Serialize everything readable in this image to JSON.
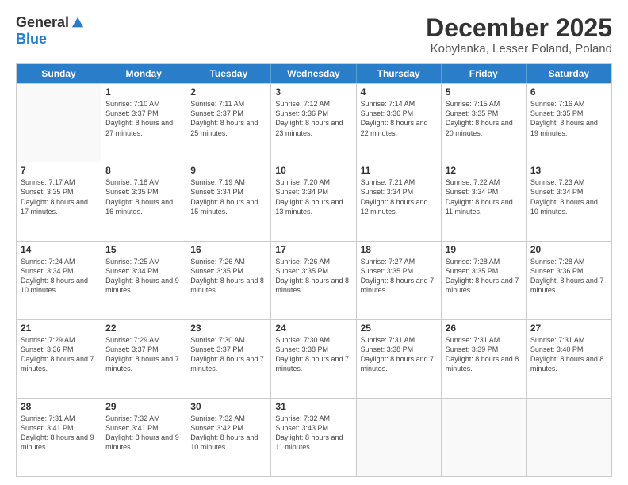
{
  "header": {
    "logo_general": "General",
    "logo_blue": "Blue",
    "month_title": "December 2025",
    "location": "Kobylanka, Lesser Poland, Poland"
  },
  "days_of_week": [
    "Sunday",
    "Monday",
    "Tuesday",
    "Wednesday",
    "Thursday",
    "Friday",
    "Saturday"
  ],
  "weeks": [
    [
      {
        "day": "",
        "info": "",
        "empty": true
      },
      {
        "day": "1",
        "info": "Sunrise: 7:10 AM\nSunset: 3:37 PM\nDaylight: 8 hours\nand 27 minutes."
      },
      {
        "day": "2",
        "info": "Sunrise: 7:11 AM\nSunset: 3:37 PM\nDaylight: 8 hours\nand 25 minutes."
      },
      {
        "day": "3",
        "info": "Sunrise: 7:12 AM\nSunset: 3:36 PM\nDaylight: 8 hours\nand 23 minutes."
      },
      {
        "day": "4",
        "info": "Sunrise: 7:14 AM\nSunset: 3:36 PM\nDaylight: 8 hours\nand 22 minutes."
      },
      {
        "day": "5",
        "info": "Sunrise: 7:15 AM\nSunset: 3:35 PM\nDaylight: 8 hours\nand 20 minutes."
      },
      {
        "day": "6",
        "info": "Sunrise: 7:16 AM\nSunset: 3:35 PM\nDaylight: 8 hours\nand 19 minutes."
      }
    ],
    [
      {
        "day": "7",
        "info": "Sunrise: 7:17 AM\nSunset: 3:35 PM\nDaylight: 8 hours\nand 17 minutes."
      },
      {
        "day": "8",
        "info": "Sunrise: 7:18 AM\nSunset: 3:35 PM\nDaylight: 8 hours\nand 16 minutes."
      },
      {
        "day": "9",
        "info": "Sunrise: 7:19 AM\nSunset: 3:34 PM\nDaylight: 8 hours\nand 15 minutes."
      },
      {
        "day": "10",
        "info": "Sunrise: 7:20 AM\nSunset: 3:34 PM\nDaylight: 8 hours\nand 13 minutes."
      },
      {
        "day": "11",
        "info": "Sunrise: 7:21 AM\nSunset: 3:34 PM\nDaylight: 8 hours\nand 12 minutes."
      },
      {
        "day": "12",
        "info": "Sunrise: 7:22 AM\nSunset: 3:34 PM\nDaylight: 8 hours\nand 11 minutes."
      },
      {
        "day": "13",
        "info": "Sunrise: 7:23 AM\nSunset: 3:34 PM\nDaylight: 8 hours\nand 10 minutes."
      }
    ],
    [
      {
        "day": "14",
        "info": "Sunrise: 7:24 AM\nSunset: 3:34 PM\nDaylight: 8 hours\nand 10 minutes."
      },
      {
        "day": "15",
        "info": "Sunrise: 7:25 AM\nSunset: 3:34 PM\nDaylight: 8 hours\nand 9 minutes."
      },
      {
        "day": "16",
        "info": "Sunrise: 7:26 AM\nSunset: 3:35 PM\nDaylight: 8 hours\nand 8 minutes."
      },
      {
        "day": "17",
        "info": "Sunrise: 7:26 AM\nSunset: 3:35 PM\nDaylight: 8 hours\nand 8 minutes."
      },
      {
        "day": "18",
        "info": "Sunrise: 7:27 AM\nSunset: 3:35 PM\nDaylight: 8 hours\nand 7 minutes."
      },
      {
        "day": "19",
        "info": "Sunrise: 7:28 AM\nSunset: 3:35 PM\nDaylight: 8 hours\nand 7 minutes."
      },
      {
        "day": "20",
        "info": "Sunrise: 7:28 AM\nSunset: 3:36 PM\nDaylight: 8 hours\nand 7 minutes."
      }
    ],
    [
      {
        "day": "21",
        "info": "Sunrise: 7:29 AM\nSunset: 3:36 PM\nDaylight: 8 hours\nand 7 minutes."
      },
      {
        "day": "22",
        "info": "Sunrise: 7:29 AM\nSunset: 3:37 PM\nDaylight: 8 hours\nand 7 minutes."
      },
      {
        "day": "23",
        "info": "Sunrise: 7:30 AM\nSunset: 3:37 PM\nDaylight: 8 hours\nand 7 minutes."
      },
      {
        "day": "24",
        "info": "Sunrise: 7:30 AM\nSunset: 3:38 PM\nDaylight: 8 hours\nand 7 minutes."
      },
      {
        "day": "25",
        "info": "Sunrise: 7:31 AM\nSunset: 3:38 PM\nDaylight: 8 hours\nand 7 minutes."
      },
      {
        "day": "26",
        "info": "Sunrise: 7:31 AM\nSunset: 3:39 PM\nDaylight: 8 hours\nand 8 minutes."
      },
      {
        "day": "27",
        "info": "Sunrise: 7:31 AM\nSunset: 3:40 PM\nDaylight: 8 hours\nand 8 minutes."
      }
    ],
    [
      {
        "day": "28",
        "info": "Sunrise: 7:31 AM\nSunset: 3:41 PM\nDaylight: 8 hours\nand 9 minutes."
      },
      {
        "day": "29",
        "info": "Sunrise: 7:32 AM\nSunset: 3:41 PM\nDaylight: 8 hours\nand 9 minutes."
      },
      {
        "day": "30",
        "info": "Sunrise: 7:32 AM\nSunset: 3:42 PM\nDaylight: 8 hours\nand 10 minutes."
      },
      {
        "day": "31",
        "info": "Sunrise: 7:32 AM\nSunset: 3:43 PM\nDaylight: 8 hours\nand 11 minutes."
      },
      {
        "day": "",
        "info": "",
        "empty": true
      },
      {
        "day": "",
        "info": "",
        "empty": true
      },
      {
        "day": "",
        "info": "",
        "empty": true
      }
    ]
  ]
}
